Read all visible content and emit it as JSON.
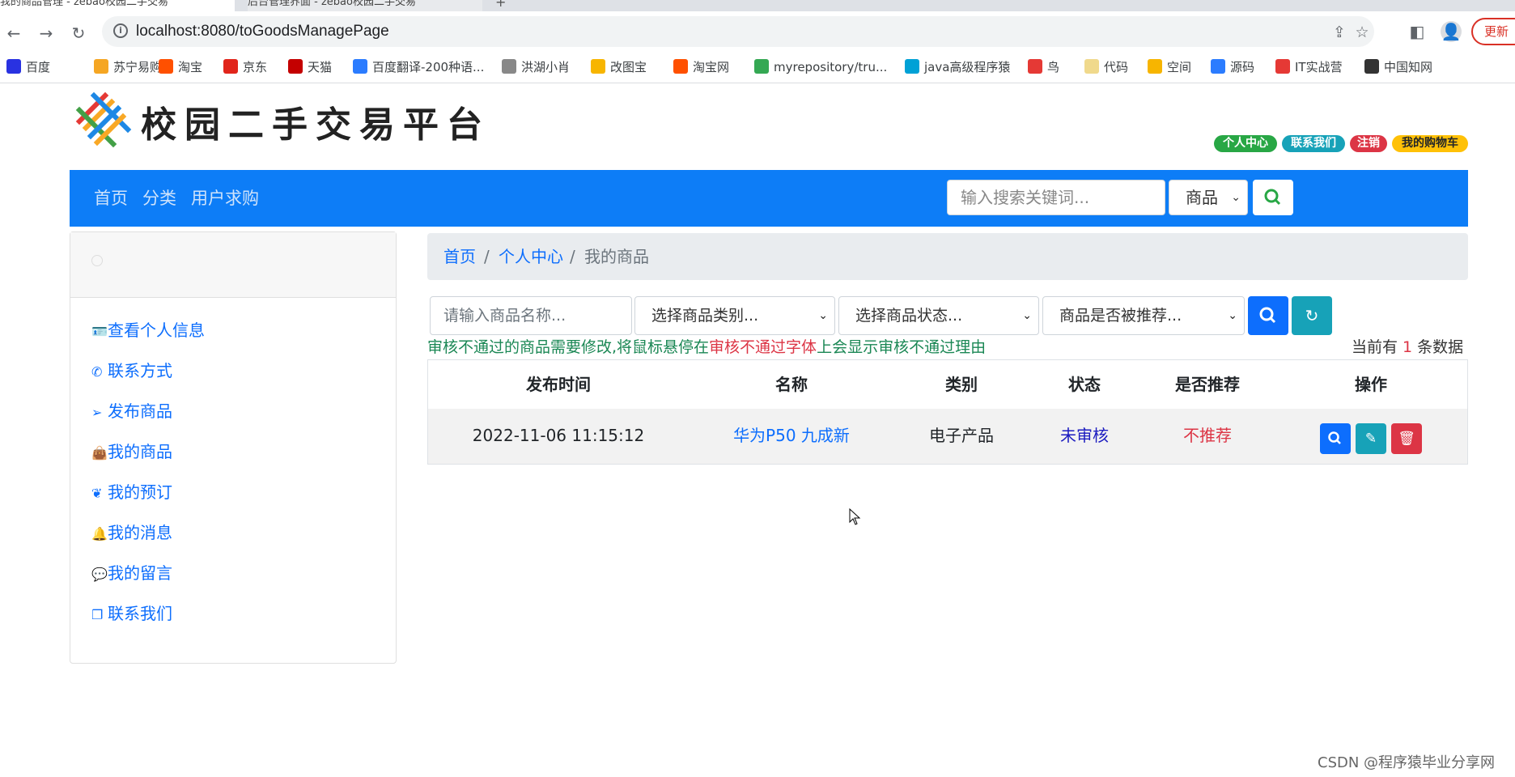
{
  "browser": {
    "tabs": [
      {
        "label": "我的商品管理 - zebao校园二手交易"
      },
      {
        "label": "后台管理界面 - zebao校园二手交易"
      }
    ],
    "new_tab": "+",
    "url": "localhost:8080/toGoodsManagePage",
    "update_label": "更新",
    "bookmarks": [
      {
        "label": "百度",
        "icon": "paw-icon",
        "color": "#2932e1"
      },
      {
        "label": "苏宁易购",
        "icon": "suning-icon",
        "color": "#f5a623"
      },
      {
        "label": "淘宝",
        "icon": "taobao-icon",
        "color": "#ff5000"
      },
      {
        "label": "京东",
        "icon": "jd-icon",
        "color": "#e1251b"
      },
      {
        "label": "天猫",
        "icon": "tmall-icon",
        "color": "#c40000"
      },
      {
        "label": "百度翻译-200种语...",
        "icon": "translate-icon",
        "color": "#2b7cff"
      },
      {
        "label": "洪湖小肖",
        "icon": "bird-icon",
        "color": "#888888"
      },
      {
        "label": "改图宝",
        "icon": "folder-icon",
        "color": "#f7b500"
      },
      {
        "label": "淘宝网",
        "icon": "taobao-icon",
        "color": "#ff5000"
      },
      {
        "label": "myrepository/tru...",
        "icon": "chrome-icon",
        "color": "#34a853"
      },
      {
        "label": "java高级程序猿",
        "icon": "bilibili-icon",
        "color": "#00a1d6"
      },
      {
        "label": "鸟",
        "icon": "bird-icon",
        "color": "#e53935"
      },
      {
        "label": "代码",
        "icon": "moon-icon",
        "color": "#f0d98c"
      },
      {
        "label": "空间",
        "icon": "qzone-icon",
        "color": "#f7b500"
      },
      {
        "label": "源码",
        "icon": "dolphin-icon",
        "color": "#2b7cff"
      },
      {
        "label": "IT实战营",
        "icon": "circle-icon",
        "color": "#e53935"
      },
      {
        "label": "中国知网",
        "icon": "cnki-icon",
        "color": "#333333"
      }
    ]
  },
  "site": {
    "title": "校园二手交易平台",
    "badges": [
      {
        "label": "个人中心",
        "color": "#28a745"
      },
      {
        "label": "联系我们",
        "color": "#17a2b8"
      },
      {
        "label": "注销",
        "color": "#dc3545"
      },
      {
        "label": "我的购物车",
        "color": "#ffc107",
        "text_color": "#212529"
      }
    ],
    "nav": [
      {
        "label": "首页"
      },
      {
        "label": "分类"
      },
      {
        "label": "用户求购"
      }
    ],
    "search": {
      "placeholder": "输入搜索关键词...",
      "type_value": "商品"
    }
  },
  "sidebar": {
    "items": [
      {
        "label": "查看个人信息",
        "icon": "id-card-icon"
      },
      {
        "label": "联系方式",
        "icon": "phone-icon"
      },
      {
        "label": "发布商品",
        "icon": "send-icon"
      },
      {
        "label": "我的商品",
        "icon": "bag-icon"
      },
      {
        "label": "我的预订",
        "icon": "leaf-icon"
      },
      {
        "label": "我的消息",
        "icon": "bell-icon"
      },
      {
        "label": "我的留言",
        "icon": "chat-icon"
      },
      {
        "label": "联系我们",
        "icon": "copy-icon"
      }
    ]
  },
  "breadcrumb": {
    "items": [
      "首页",
      "个人中心",
      "我的商品"
    ],
    "separator": "/"
  },
  "filters": {
    "name_placeholder": "请输入商品名称...",
    "category_value": "选择商品类别...",
    "status_value": "选择商品状态...",
    "recommend_value": "商品是否被推荐..."
  },
  "notice": {
    "part1": "审核不通过的商品需要修改,将鼠标悬停在",
    "part2": "审核不通过字体",
    "part3": "上会显示审核不通过理由"
  },
  "count": {
    "prefix": "当前有 ",
    "number": "1",
    "suffix": " 条数据"
  },
  "table": {
    "headers": [
      "发布时间",
      "名称",
      "类别",
      "状态",
      "是否推荐",
      "操作"
    ],
    "rows": [
      {
        "time": "2022-11-06 11:15:12",
        "name": "华为P50 九成新",
        "category": "电子产品",
        "status": "未审核",
        "recommend": "不推荐"
      }
    ]
  },
  "watermark": "CSDN @程序猿毕业分享网",
  "colors": {
    "navbar": "#0d7df7",
    "primary": "#0d6efd",
    "info": "#17a2b8",
    "danger": "#dc3545",
    "success": "#28a745",
    "status_pending": "#1c1cc0"
  }
}
